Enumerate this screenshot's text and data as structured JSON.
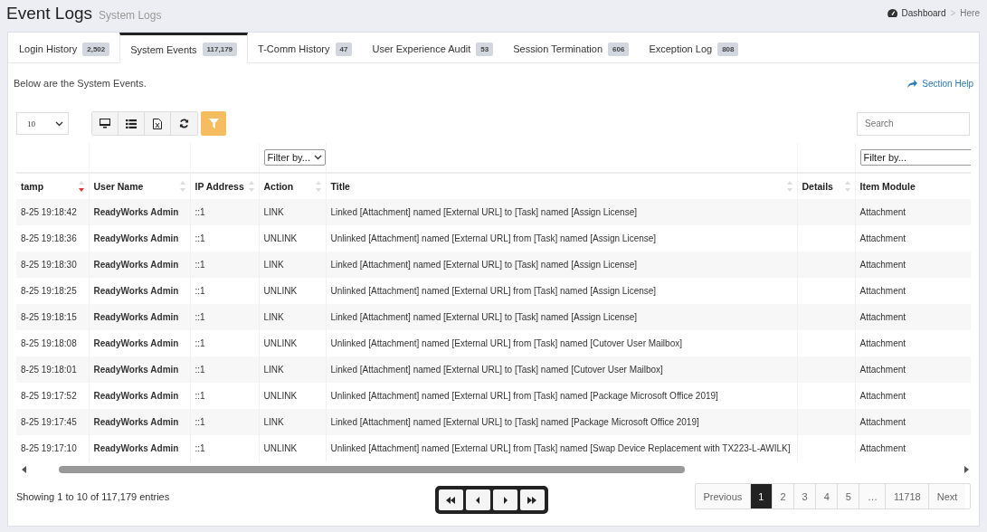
{
  "header": {
    "title": "Event Logs",
    "subtitle": "System Logs",
    "breadcrumb": [
      "Dashboard",
      "Here"
    ],
    "separator": ">"
  },
  "tabs": [
    {
      "label": "Login History",
      "count": "2,502",
      "selected": false
    },
    {
      "label": "System Events",
      "count": "117,179",
      "selected": true
    },
    {
      "label": "T-Comm History",
      "count": "47",
      "selected": false
    },
    {
      "label": "User Experience Audit",
      "count": "53",
      "selected": false
    },
    {
      "label": "Session Termination",
      "count": "606",
      "selected": false
    },
    {
      "label": "Exception Log",
      "count": "808",
      "selected": false
    }
  ],
  "intro": "Below are the System Events.",
  "help_link": "Section Help",
  "toolbar": {
    "page_size": "10",
    "filter_active": true,
    "search": {
      "placeholder": "Search"
    }
  },
  "table": {
    "columns": [
      {
        "label": "tamp",
        "sortable": true,
        "sorted_desc": true
      },
      {
        "label": "User Name",
        "sortable": true,
        "sorted_desc": false
      },
      {
        "label": "IP Address",
        "sortable": true,
        "sorted_desc": false
      },
      {
        "label": "Action",
        "sortable": true,
        "sorted_desc": false,
        "filter": {
          "kind": "select",
          "text": "Filter by..."
        }
      },
      {
        "label": "Title",
        "sortable": true,
        "sorted_desc": false
      },
      {
        "label": "Details",
        "sortable": true,
        "sorted_desc": false
      },
      {
        "label": "Item Module",
        "sortable": false,
        "filter": {
          "kind": "input",
          "text": "Filter by..."
        }
      }
    ],
    "rows": [
      [
        "8-25 19:18:42",
        "ReadyWorks Admin",
        "::1",
        "LINK",
        "Linked [Attachment] named [External URL] to [Task] named [Assign License]",
        "",
        "Attachment"
      ],
      [
        "8-25 19:18:36",
        "ReadyWorks Admin",
        "::1",
        "UNLINK",
        "Unlinked [Attachment] named [External URL] from [Task] named [Assign License]",
        "",
        "Attachment"
      ],
      [
        "8-25 19:18:30",
        "ReadyWorks Admin",
        "::1",
        "LINK",
        "Linked [Attachment] named [External URL] to [Task] named [Assign License]",
        "",
        "Attachment"
      ],
      [
        "8-25 19:18:25",
        "ReadyWorks Admin",
        "::1",
        "UNLINK",
        "Unlinked [Attachment] named [External URL] from [Task] named [Assign License]",
        "",
        "Attachment"
      ],
      [
        "8-25 19:18:15",
        "ReadyWorks Admin",
        "::1",
        "LINK",
        "Linked [Attachment] named [External URL] to [Task] named [Assign License]",
        "",
        "Attachment"
      ],
      [
        "8-25 19:18:08",
        "ReadyWorks Admin",
        "::1",
        "UNLINK",
        "Unlinked [Attachment] named [External URL] from [Task] named [Cutover User Mailbox]",
        "",
        "Attachment"
      ],
      [
        "8-25 19:18:01",
        "ReadyWorks Admin",
        "::1",
        "LINK",
        "Linked [Attachment] named [External URL] to [Task] named [Cutover User Mailbox]",
        "",
        "Attachment"
      ],
      [
        "8-25 19:17:52",
        "ReadyWorks Admin",
        "::1",
        "UNLINK",
        "Unlinked [Attachment] named [External URL] from [Task] named [Package Microsoft Office 2019]",
        "",
        "Attachment"
      ],
      [
        "8-25 19:17:45",
        "ReadyWorks Admin",
        "::1",
        "LINK",
        "Linked [Attachment] named [External URL] to [Task] named [Package Microsoft Office 2019]",
        "",
        "Attachment"
      ],
      [
        "8-25 19:17:10",
        "ReadyWorks Admin",
        "::1",
        "UNLINK",
        "Unlinked [Attachment] named [External URL] from [Task] named [Swap Device Replacement with TX223-L-AWILK]",
        "",
        "Attachment"
      ]
    ]
  },
  "footer": {
    "info": "Showing 1 to 10 of 117,179 entries",
    "pages": [
      {
        "label": "Previous",
        "selected": false
      },
      {
        "label": "1",
        "selected": true
      },
      {
        "label": "2",
        "selected": false
      },
      {
        "label": "3",
        "selected": false
      },
      {
        "label": "4",
        "selected": false
      },
      {
        "label": "5",
        "selected": false
      },
      {
        "label": "…",
        "selected": false
      },
      {
        "label": "11718",
        "selected": false
      },
      {
        "label": "Next",
        "selected": false
      }
    ]
  }
}
